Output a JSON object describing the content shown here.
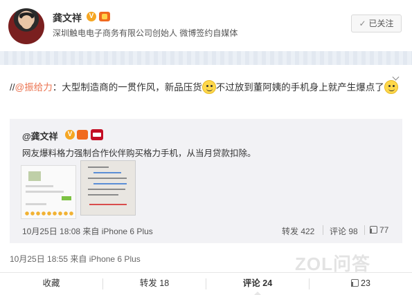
{
  "author": {
    "name": "龚文祥",
    "bio": "深圳触电电子商务有限公司创始人 微博签约自媒体",
    "verified_badge": "V",
    "follow_label": "已关注",
    "follow_check": "✓"
  },
  "post": {
    "prefix": "//",
    "mention": "@振给力",
    "text_part1": "：大型制造商的一贯作风，新品压货",
    "text_part2": "不过放到董阿姨的手机身上就产生爆点了",
    "time_source": "10月25日 18:55 来自 iPhone 6 Plus"
  },
  "repost": {
    "author": "@龚文祥",
    "verified_badge": "V",
    "text": "网友爆料格力强制合作伙伴购买格力手机，从当月贷款扣除。",
    "time_source": "10月25日 18:08 来自 iPhone 6 Plus",
    "repost_label": "转发 422",
    "comment_label": "评论 98",
    "like_count": "77"
  },
  "actions": {
    "favorite": "收藏",
    "repost": "转发 18",
    "comment": "评论 24",
    "like": "23"
  },
  "watermark": "ZOL问答",
  "icons": [
    "more-chevron-icon",
    "verified-icon",
    "level-icon",
    "tmall-icon",
    "thumbs-up-icon",
    "check-icon",
    "emoji-icon"
  ],
  "colors": {
    "mention": "#eb7350",
    "badge": "#f5a623",
    "repost_bg": "#f2f2f5"
  }
}
